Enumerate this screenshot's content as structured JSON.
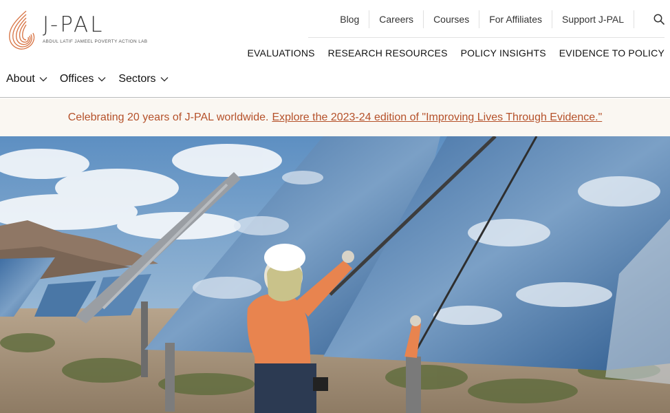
{
  "brand": {
    "name": "J-PAL",
    "tagline": "ABDUL LATIF JAMEEL POVERTY ACTION LAB",
    "accent_color": "#d9784a"
  },
  "utility_nav": {
    "items": [
      "Blog",
      "Careers",
      "Courses",
      "For Affiliates",
      "Support J-PAL"
    ],
    "search_icon": "search-icon"
  },
  "main_nav": {
    "items": [
      "EVALUATIONS",
      "RESEARCH RESOURCES",
      "POLICY INSIGHTS",
      "EVIDENCE TO POLICY"
    ]
  },
  "sub_nav": {
    "items": [
      "About",
      "Offices",
      "Sectors"
    ],
    "dropdown_icon": "chevron-down-icon"
  },
  "banner": {
    "text": "Celebrating 20 years of J-PAL worldwide.",
    "link_text": "Explore the 2023-24 edition of \"Improving Lives Through Evidence.\"",
    "text_color": "#b5512a",
    "background": "#faf7f2"
  },
  "hero": {
    "image_icon": "solar-mirror-worker-photo"
  }
}
